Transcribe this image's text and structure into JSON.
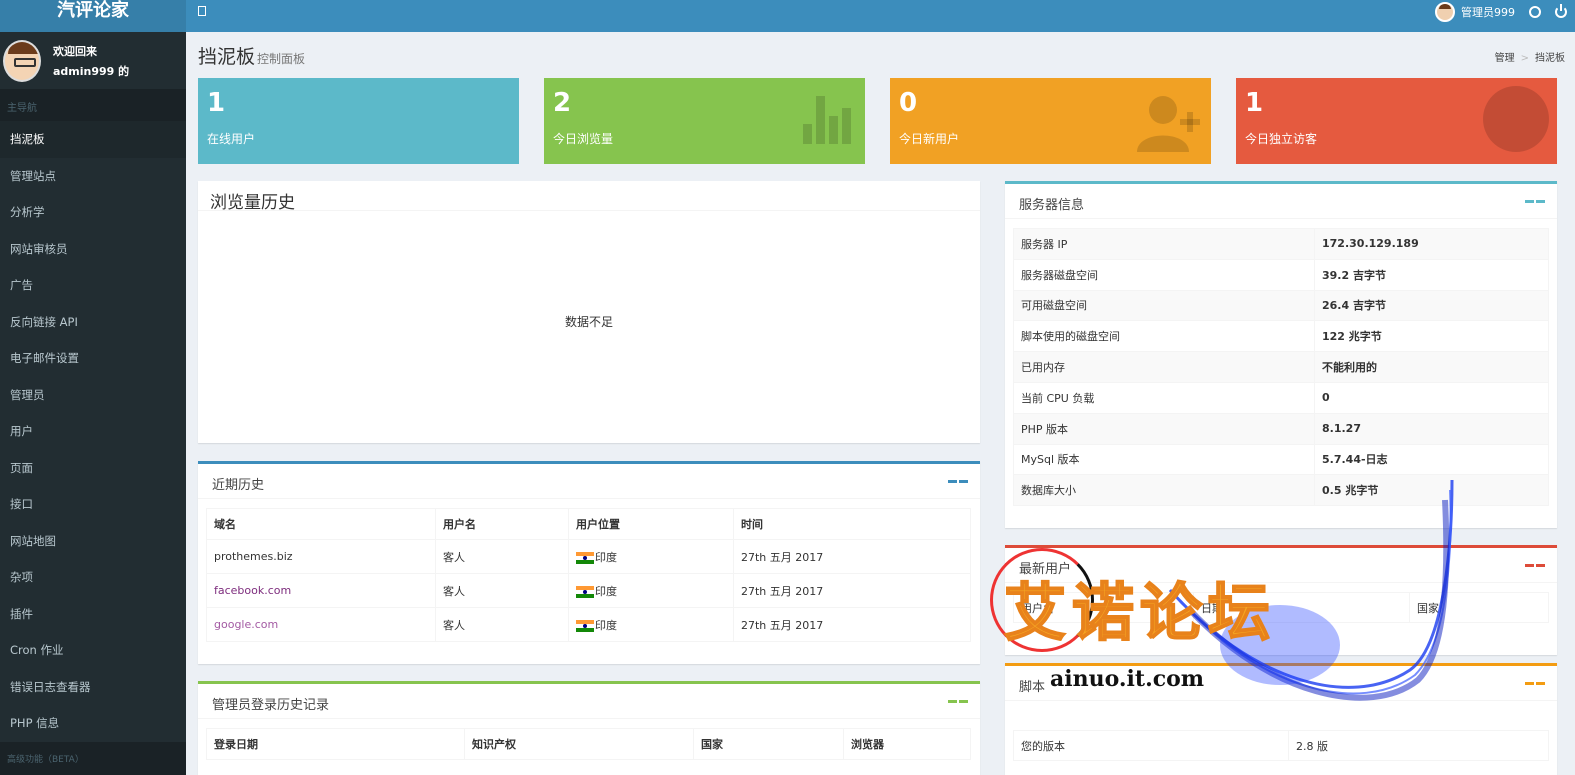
{
  "app": {
    "logo": "汽评论家"
  },
  "topbar": {
    "username": "管理员999"
  },
  "sidebar": {
    "welcome": "欢迎回来",
    "user": "admin999 的",
    "nav_header": "主导航",
    "items": [
      {
        "label": "挡泥板"
      },
      {
        "label": "管理站点"
      },
      {
        "label": "分析学"
      },
      {
        "label": "网站审核员"
      },
      {
        "label": "广告"
      },
      {
        "label": "反向链接 API"
      },
      {
        "label": "电子邮件设置"
      },
      {
        "label": "管理员"
      },
      {
        "label": "用户"
      },
      {
        "label": "页面"
      },
      {
        "label": "接口"
      },
      {
        "label": "网站地图"
      },
      {
        "label": "杂项"
      },
      {
        "label": "插件"
      },
      {
        "label": "Cron 作业"
      },
      {
        "label": "错误日志查看器"
      },
      {
        "label": "PHP 信息"
      }
    ],
    "footer": "高级功能（BETA）"
  },
  "header": {
    "title": "挡泥板",
    "subtitle": "控制面板",
    "breadcrumb": [
      "管理",
      "挡泥板"
    ]
  },
  "stats": [
    {
      "value": "1",
      "label": "在线用户"
    },
    {
      "value": "2",
      "label": "今日浏览量"
    },
    {
      "value": "0",
      "label": "今日新用户"
    },
    {
      "value": "1",
      "label": "今日独立访客"
    }
  ],
  "history": {
    "title": "浏览量历史",
    "empty": "数据不足"
  },
  "recent": {
    "title": "近期历史",
    "columns": [
      "域名",
      "用户名",
      "用户位置",
      "时间"
    ],
    "rows": [
      [
        "prothemes.biz",
        "客人",
        "印度",
        "27th 五月 2017"
      ],
      [
        "facebook.com",
        "客人",
        "印度",
        "27th 五月 2017"
      ],
      [
        "google.com",
        "客人",
        "印度",
        "27th 五月 2017"
      ]
    ]
  },
  "admin_history": {
    "title": "管理员登录历史记录",
    "columns": [
      "登录日期",
      "知识产权",
      "国家",
      "浏览器"
    ]
  },
  "server": {
    "title": "服务器信息",
    "rows": [
      [
        "服务器 IP",
        "172.30.129.189"
      ],
      [
        "服务器磁盘空间",
        "39.2 吉字节"
      ],
      [
        "可用磁盘空间",
        "26.4 吉字节"
      ],
      [
        "脚本使用的磁盘空间",
        "122 兆字节"
      ],
      [
        "已用内存",
        "不能利用的"
      ],
      [
        "当前 CPU 负载",
        "0"
      ],
      [
        "PHP 版本",
        "8.1.27"
      ],
      [
        "MySql 版本",
        "5.7.44-日志"
      ],
      [
        "数据库大小",
        "0.5 兆字节"
      ]
    ]
  },
  "new_users": {
    "title": "最新用户",
    "col1": "用户名",
    "col2": "日期",
    "col3": "国家"
  },
  "script": {
    "title": "脚本",
    "rows": [
      [
        "您的版本",
        "2.8 版"
      ]
    ]
  },
  "watermark": {
    "text": "艾诺论坛",
    "url": "ainuo.it.com"
  },
  "colors": {
    "topbar": "#3c8dbc",
    "sidebar": "#222d32",
    "aqua": "#5cb9c9",
    "green": "#86c44e",
    "orange": "#f1a124",
    "red": "#e55a3f"
  }
}
